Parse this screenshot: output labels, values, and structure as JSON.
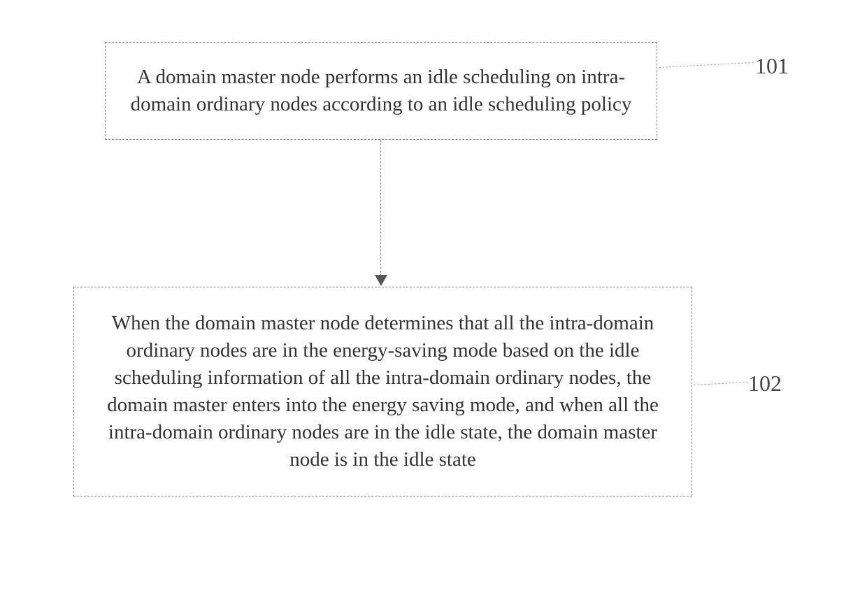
{
  "boxes": {
    "step1": {
      "text": "A domain master node performs an idle scheduling on intra-domain ordinary nodes according to an idle scheduling policy",
      "ref": "101"
    },
    "step2": {
      "text": "When the domain master node determines that all the intra-domain ordinary nodes are in the energy-saving mode based on the idle scheduling information of all the intra-domain ordinary nodes, the domain master enters into the energy saving mode, and when all the intra-domain ordinary nodes are in the idle state, the domain master node is in the idle state",
      "ref": "102"
    }
  }
}
